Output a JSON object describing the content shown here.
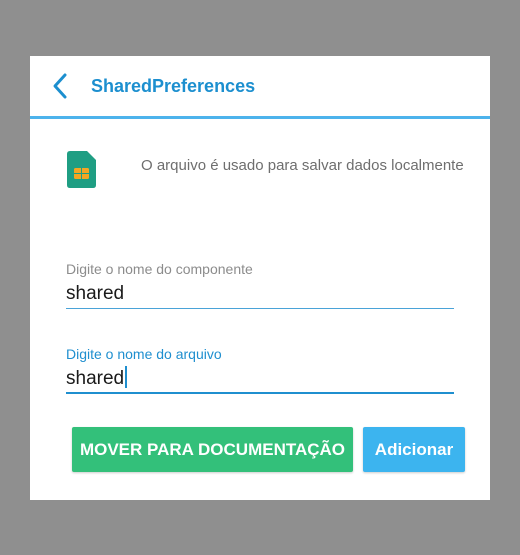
{
  "header": {
    "title": "SharedPreferences",
    "back_icon": "chevron-left-icon"
  },
  "info": {
    "icon": "sim-card-icon",
    "description": "O arquivo é usado para salvar dados localmente"
  },
  "fields": {
    "component": {
      "label": "Digite o nome do componente",
      "value": "shared"
    },
    "file": {
      "label": "Digite o nome do arquivo",
      "value": "shared"
    }
  },
  "buttons": {
    "move": "MOVER PARA DOCUMENTAÇÃO",
    "add": "Adicionar"
  },
  "colors": {
    "accent": "#1c8fcf",
    "header_line": "#4db3ec",
    "move_button": "#33c07a",
    "add_button": "#3cb4ef",
    "sim_icon": "#1f9e83",
    "chip": "#f5a623"
  }
}
